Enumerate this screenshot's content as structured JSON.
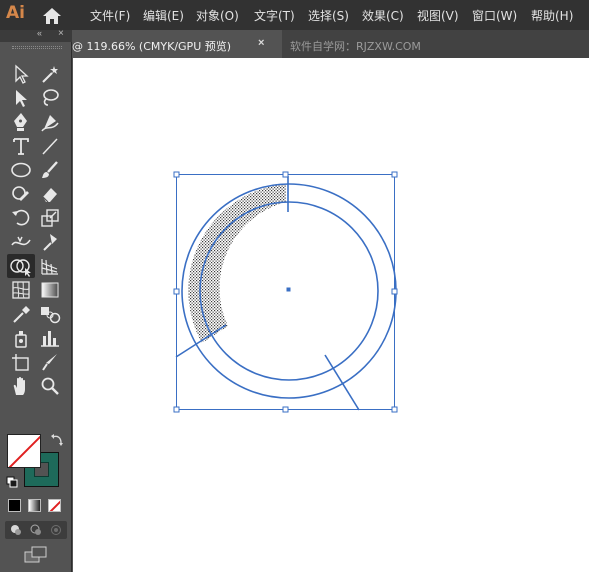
{
  "app": {
    "logo": "Ai"
  },
  "menu": [
    {
      "label": "文件(F)"
    },
    {
      "label": "编辑(E)"
    },
    {
      "label": "对象(O)"
    },
    {
      "label": "文字(T)"
    },
    {
      "label": "选择(S)"
    },
    {
      "label": "效果(C)"
    },
    {
      "label": "视图(V)"
    },
    {
      "label": "窗口(W)"
    },
    {
      "label": "帮助(H)"
    }
  ],
  "tabs": {
    "document_title": "@ 119.66% (CMYK/GPU 预览)",
    "close_glyph": "×",
    "watermark": "软件自学网：RJZXW.COM"
  },
  "toolbar": {
    "collapse_glyph": "«",
    "close_glyph": "×",
    "more_glyph": "•••",
    "colors": {
      "fill": "#ffffff",
      "stroke": "#1e6a5a",
      "none_slash": "#e02020"
    }
  },
  "colors": {
    "selection": "#3a6fc4",
    "path_stroke": "#3a6fc4",
    "canvas": "#ffffff",
    "menubar": "#323232",
    "toolbar": "#535353"
  }
}
